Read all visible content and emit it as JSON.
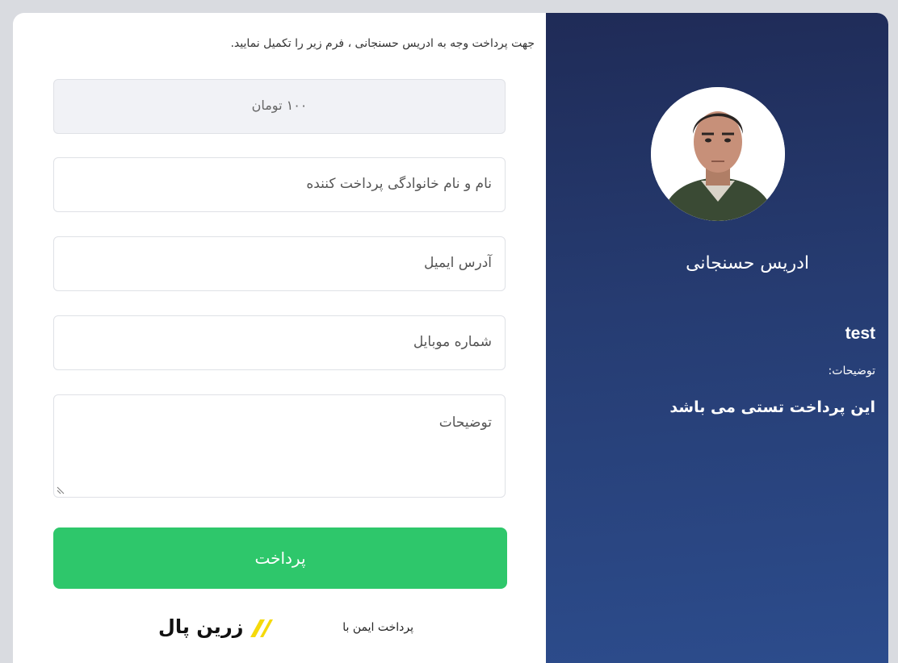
{
  "profile": {
    "name": "ادریس حسنجانی",
    "product_title": "test",
    "description_label": "توضیحات:",
    "description_text": "این پرداخت تستی می باشد"
  },
  "form": {
    "intro": "جهت پرداخت وجه به ادریس حسنجانی ، فرم زیر را تکمیل نمایید.",
    "amount": "۱۰۰ تومان",
    "fullname_placeholder": "نام و نام خانوادگی پرداخت کننده",
    "email_placeholder": "آدرس ایمیل",
    "mobile_placeholder": "شماره موبایل",
    "description_placeholder": "توضیحات",
    "pay_button": "پرداخت",
    "secure_text": "پرداخت ایمن با",
    "brand_name": "زرین پال"
  },
  "colors": {
    "panel_start": "#1f2b57",
    "panel_end": "#2c4c8c",
    "button": "#2ec76b",
    "brand_accent": "#f5d90a"
  },
  "icons": {
    "avatar": "user-photo",
    "brand": "zarinpal-logo-icon",
    "resize": "resize-grip-icon"
  }
}
